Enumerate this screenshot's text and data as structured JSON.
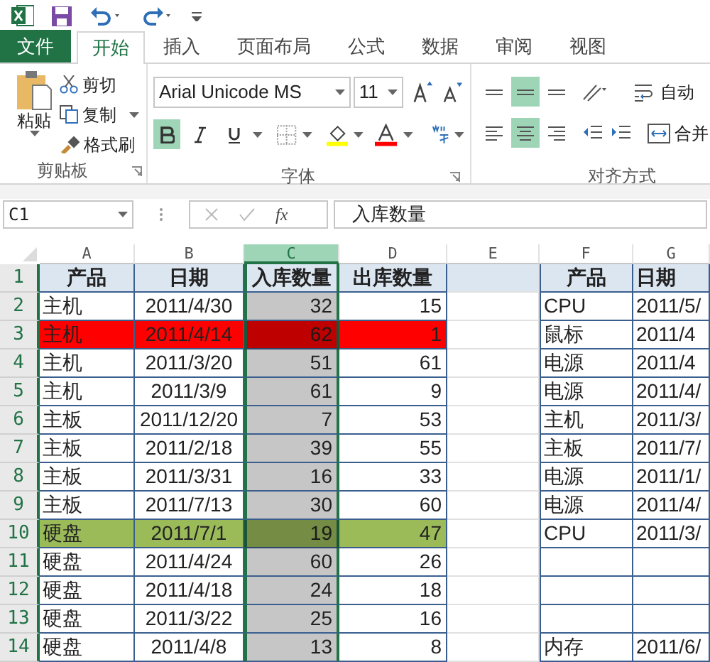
{
  "tabs": [
    {
      "label": "文件",
      "kind": "file",
      "selected": false
    },
    {
      "label": "开始",
      "kind": "normal",
      "selected": true
    },
    {
      "label": "插入",
      "kind": "normal",
      "selected": false
    },
    {
      "label": "页面布局",
      "kind": "normal",
      "selected": false
    },
    {
      "label": "公式",
      "kind": "normal",
      "selected": false
    },
    {
      "label": "数据",
      "kind": "normal",
      "selected": false
    },
    {
      "label": "审阅",
      "kind": "normal",
      "selected": false
    },
    {
      "label": "视图",
      "kind": "normal",
      "selected": false
    }
  ],
  "clipboard": {
    "paste": "粘贴",
    "cut": "剪切",
    "copy": "复制",
    "format_painter": "格式刷",
    "label": "剪贴板"
  },
  "font": {
    "name": "Arial Unicode MS",
    "size": "11",
    "bold": true,
    "italic": false,
    "underline": false,
    "label": "字体"
  },
  "alignment": {
    "top": false,
    "middle": true,
    "bottom": false,
    "left": false,
    "center": true,
    "right": false,
    "wrap": "自动",
    "merge": "合并",
    "label": "对齐方式"
  },
  "formula_bar": {
    "name_box": "C1",
    "fx": "fx",
    "formula": "入库数量"
  },
  "columns": [
    {
      "letter": "A",
      "selected": false
    },
    {
      "letter": "B",
      "selected": false
    },
    {
      "letter": "C",
      "selected": true
    },
    {
      "letter": "D",
      "selected": false
    },
    {
      "letter": "E",
      "selected": false
    },
    {
      "letter": "F",
      "selected": false
    },
    {
      "letter": "G",
      "selected": false
    }
  ],
  "rows": [
    {
      "number": "1",
      "kind": "header",
      "cells": [
        "产品",
        "日期",
        "入库数量",
        "出库数量",
        "",
        "产品",
        "日期"
      ]
    },
    {
      "number": "2",
      "kind": "data",
      "cells": [
        "主机",
        "2011/4/30",
        "32",
        "15",
        "",
        "CPU",
        "2011/5/"
      ]
    },
    {
      "number": "3",
      "kind": "data",
      "color": "#ff0000",
      "cells": [
        "主机",
        "2011/4/14",
        "62",
        "1",
        "",
        "鼠标",
        "2011/4"
      ]
    },
    {
      "number": "4",
      "kind": "data",
      "cells": [
        "主机",
        "2011/3/20",
        "51",
        "61",
        "",
        "电源",
        "2011/4"
      ]
    },
    {
      "number": "5",
      "kind": "data",
      "cells": [
        "主机",
        "2011/3/9",
        "61",
        "9",
        "",
        "电源",
        "2011/4/"
      ]
    },
    {
      "number": "6",
      "kind": "data",
      "cells": [
        "主板",
        "2011/12/20",
        "7",
        "53",
        "",
        "主机",
        "2011/3/"
      ]
    },
    {
      "number": "7",
      "kind": "data",
      "cells": [
        "主板",
        "2011/2/18",
        "39",
        "55",
        "",
        "主板",
        "2011/7/"
      ]
    },
    {
      "number": "8",
      "kind": "data",
      "cells": [
        "主板",
        "2011/3/31",
        "16",
        "33",
        "",
        "电源",
        "2011/1/"
      ]
    },
    {
      "number": "9",
      "kind": "data",
      "cells": [
        "主板",
        "2011/7/13",
        "30",
        "60",
        "",
        "电源",
        "2011/4/"
      ]
    },
    {
      "number": "10",
      "kind": "data",
      "color": "#9bbb59",
      "cells": [
        "硬盘",
        "2011/7/1",
        "19",
        "47",
        "",
        "CPU",
        "2011/3/"
      ]
    },
    {
      "number": "11",
      "kind": "data",
      "cells": [
        "硬盘",
        "2011/4/24",
        "60",
        "26",
        "",
        "",
        ""
      ]
    },
    {
      "number": "12",
      "kind": "data",
      "cells": [
        "硬盘",
        "2011/4/18",
        "24",
        "18",
        "",
        "",
        ""
      ]
    },
    {
      "number": "13",
      "kind": "data",
      "cells": [
        "硬盘",
        "2011/3/22",
        "25",
        "16",
        "",
        "",
        ""
      ]
    },
    {
      "number": "14",
      "kind": "data",
      "cells": [
        "硬盘",
        "2011/4/8",
        "13",
        "8",
        "",
        "内存",
        "2011/6/"
      ]
    }
  ]
}
